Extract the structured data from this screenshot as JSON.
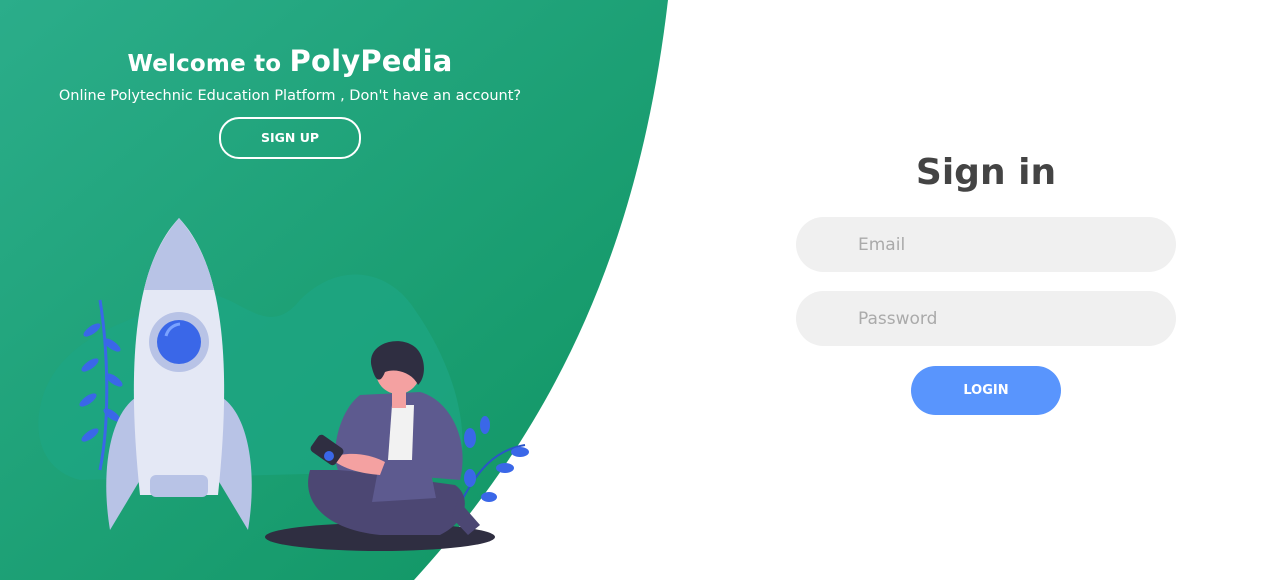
{
  "left_panel": {
    "welcome_prefix": "Welcome to ",
    "brand": "PolyPedia",
    "tagline": "Online Polytechnic Education Platform , Don't have an account?",
    "signup_label": "SIGN UP"
  },
  "signin": {
    "title": "Sign in",
    "email_placeholder": "Email",
    "password_placeholder": "Password",
    "login_label": "LOGIN"
  },
  "colors": {
    "green_start": "#2bad8a",
    "green_end": "#0f9461",
    "accent_blue": "#5995fd",
    "field_bg": "#f0f0f0",
    "title_text": "#444444"
  },
  "illustration": {
    "icons": [
      "rocket-icon",
      "plant-icon",
      "person-with-phone-icon"
    ]
  }
}
